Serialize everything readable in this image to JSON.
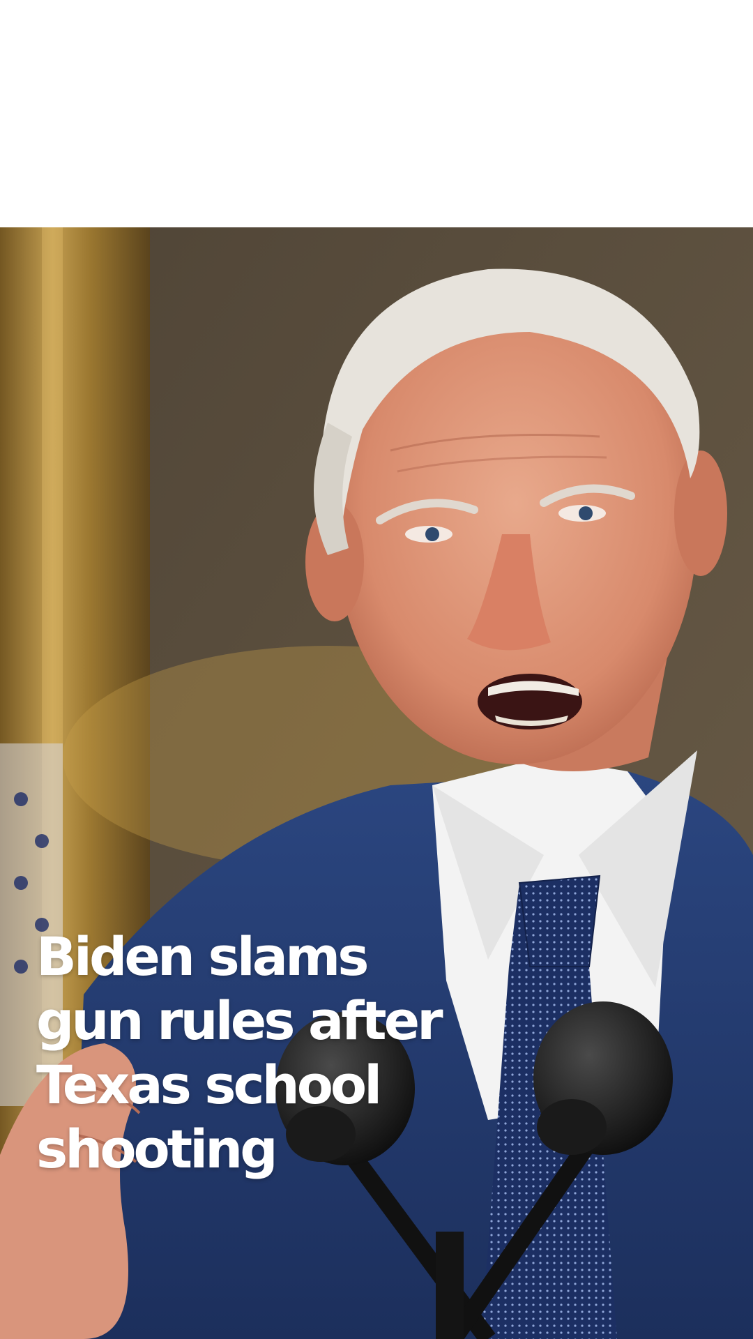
{
  "story": {
    "headline": "Biden slams gun rules after Texas school shooting",
    "photo_description_icon": "news-photo"
  },
  "colors": {
    "background": "#ffffff",
    "headline_text": "#ffffff",
    "suit_blue": "#233a6b",
    "tie_blue": "#1c2f63",
    "gold_background": "#b48a3a"
  }
}
